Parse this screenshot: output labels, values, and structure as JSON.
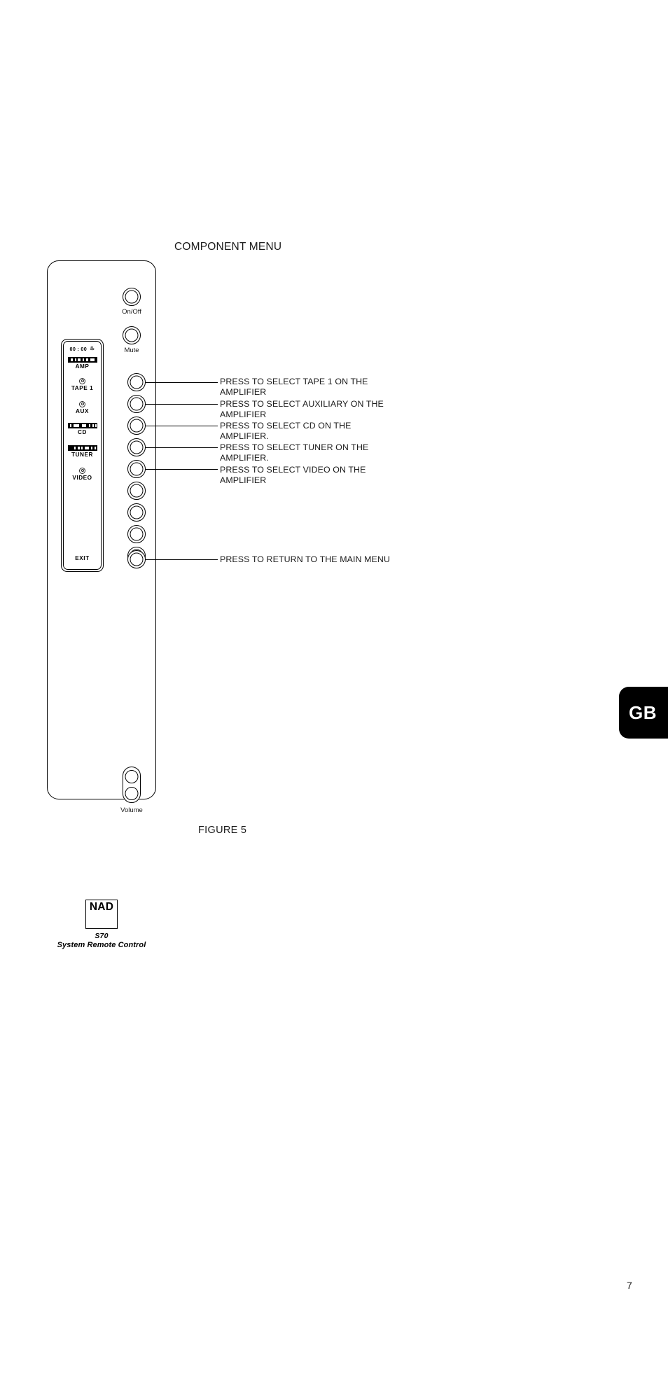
{
  "document": {
    "section_title": "COMPONENT MENU",
    "figure_caption": "FIGURE 5",
    "page_number": "7",
    "language_tab": "GB"
  },
  "remote": {
    "brand": {
      "logo_text": "NAD",
      "model": "S70",
      "product": "System Remote Control"
    },
    "top_buttons": [
      {
        "name": "on-off",
        "caption": "On/Off"
      },
      {
        "name": "mute",
        "caption": "Mute"
      }
    ],
    "volume": {
      "caption": "Volume",
      "up_name": "volume-up",
      "down_name": "volume-down"
    },
    "lcd": {
      "clock": "00 : 00",
      "alarm_icon": "bell-icon",
      "exit_label": "EXIT",
      "entries": [
        {
          "label": "AMP",
          "icon": "segment-bar-icon"
        },
        {
          "label": "TAPE 1",
          "icon": "disc-icon"
        },
        {
          "label": "AUX",
          "icon": "disc-icon"
        },
        {
          "label": "CD",
          "icon": "segment-bar-icon"
        },
        {
          "label": "TUNER",
          "icon": "segment-bar-icon"
        },
        {
          "label": "VIDEO",
          "icon": "disc-icon"
        }
      ]
    },
    "soft_buttons": [
      {
        "index": 1,
        "callout": "PRESS TO SELECT TAPE 1 ON THE\nAMPLIFIER"
      },
      {
        "index": 2,
        "callout": "PRESS TO SELECT AUXILIARY ON THE\nAMPLIFIER"
      },
      {
        "index": 3,
        "callout": "PRESS TO SELECT CD ON THE\nAMPLIFIER."
      },
      {
        "index": 4,
        "callout": "PRESS TO SELECT TUNER ON THE\nAMPLIFIER."
      },
      {
        "index": 5,
        "callout": "PRESS TO SELECT VIDEO ON THE\nAMPLIFIER"
      },
      {
        "index": 6,
        "callout": ""
      },
      {
        "index": 7,
        "callout": ""
      },
      {
        "index": 8,
        "callout": ""
      },
      {
        "index": 9,
        "callout": ""
      },
      {
        "index": 10,
        "callout": "PRESS TO RETURN TO THE MAIN MENU"
      }
    ]
  },
  "colors": {
    "ink": "#000000",
    "text": "#1a1a1a",
    "tab_background": "#000000",
    "tab_text": "#ffffff",
    "paper": "#ffffff"
  }
}
